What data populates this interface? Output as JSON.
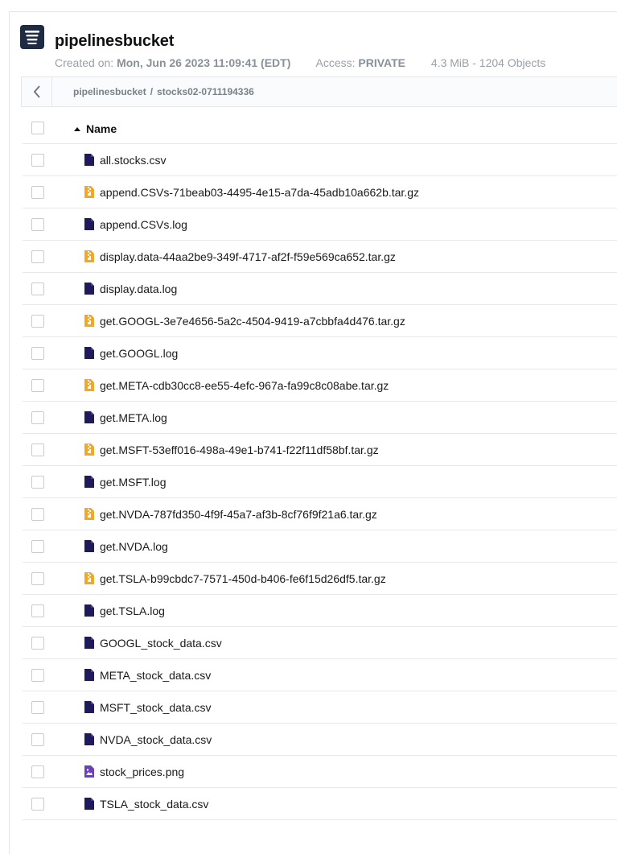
{
  "bucket": {
    "name": "pipelinesbucket",
    "created_label": "Created on:",
    "created_value": "Mon, Jun 26 2023 11:09:41 (EDT)",
    "access_label": "Access:",
    "access_value": "PRIVATE",
    "usage": "4.3 MiB - 1204 Objects"
  },
  "breadcrumb": {
    "root": "pipelinesbucket",
    "separator": "/",
    "current": "stocks02-0711194336"
  },
  "table": {
    "name_header": "Name",
    "sort": "ascending",
    "rows": [
      {
        "name": "all.stocks.csv",
        "icon": "file-icon"
      },
      {
        "name": "append.CSVs-71beab03-4495-4e15-a7da-45adb10a662b.tar.gz",
        "icon": "archive-icon"
      },
      {
        "name": "append.CSVs.log",
        "icon": "file-icon"
      },
      {
        "name": "display.data-44aa2be9-349f-4717-af2f-f59e569ca652.tar.gz",
        "icon": "archive-icon"
      },
      {
        "name": "display.data.log",
        "icon": "file-icon"
      },
      {
        "name": "get.GOOGL-3e7e4656-5a2c-4504-9419-a7cbbfa4d476.tar.gz",
        "icon": "archive-icon"
      },
      {
        "name": "get.GOOGL.log",
        "icon": "file-icon"
      },
      {
        "name": "get.META-cdb30cc8-ee55-4efc-967a-fa99c8c08abe.tar.gz",
        "icon": "archive-icon"
      },
      {
        "name": "get.META.log",
        "icon": "file-icon"
      },
      {
        "name": "get.MSFT-53eff016-498a-49e1-b741-f22f11df58bf.tar.gz",
        "icon": "archive-icon"
      },
      {
        "name": "get.MSFT.log",
        "icon": "file-icon"
      },
      {
        "name": "get.NVDA-787fd350-4f9f-45a7-af3b-8cf76f9f21a6.tar.gz",
        "icon": "archive-icon"
      },
      {
        "name": "get.NVDA.log",
        "icon": "file-icon"
      },
      {
        "name": "get.TSLA-b99cbdc7-7571-450d-b406-fe6f15d26df5.tar.gz",
        "icon": "archive-icon"
      },
      {
        "name": "get.TSLA.log",
        "icon": "file-icon"
      },
      {
        "name": "GOOGL_stock_data.csv",
        "icon": "file-icon"
      },
      {
        "name": "META_stock_data.csv",
        "icon": "file-icon"
      },
      {
        "name": "MSFT_stock_data.csv",
        "icon": "file-icon"
      },
      {
        "name": "NVDA_stock_data.csv",
        "icon": "file-icon"
      },
      {
        "name": "stock_prices.png",
        "icon": "image-icon"
      },
      {
        "name": "TSLA_stock_data.csv",
        "icon": "file-icon"
      }
    ]
  },
  "colors": {
    "file_icon": "#1f1a5c",
    "archive_icon": "#f5a623",
    "image_icon": "#6b3fc2"
  }
}
